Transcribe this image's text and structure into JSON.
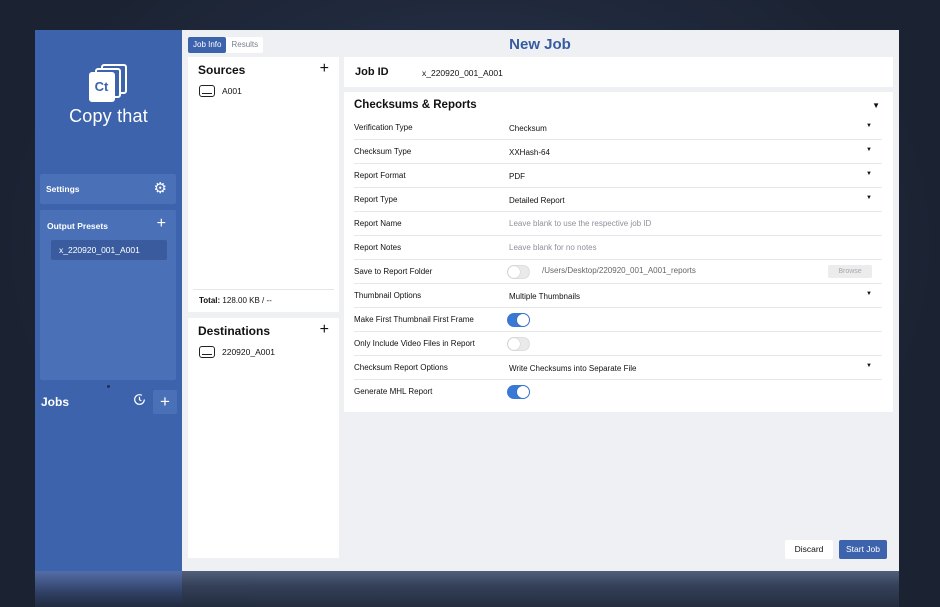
{
  "app": {
    "brand": "Copy that",
    "logo_badge": "Ct",
    "page_title": "New Job",
    "accent_color": "#3d63ac"
  },
  "tabs": [
    {
      "label": "Job Info",
      "active": true
    },
    {
      "label": "Results",
      "active": false
    }
  ],
  "sidebar": {
    "settings_label": "Settings",
    "settings_icon": "gear-icon",
    "output_presets_label": "Output Presets",
    "presets": [
      "x_220920_001_A001"
    ],
    "jobs_label": "Jobs",
    "history_icon": "history-icon"
  },
  "sources": {
    "title": "Sources",
    "items": [
      "A001"
    ],
    "total_label": "Total:",
    "total_value": "128.00 KB / --"
  },
  "destinations": {
    "title": "Destinations",
    "items": [
      "220920_A001"
    ]
  },
  "job": {
    "id_label": "Job ID",
    "id_value": "x_220920_001_A001"
  },
  "reports": {
    "title": "Checksums & Reports",
    "rows": [
      {
        "label": "Verification Type",
        "value": "Checksum"
      },
      {
        "label": "Checksum Type",
        "value": "XXHash-64"
      },
      {
        "label": "Report Format",
        "value": "PDF"
      },
      {
        "label": "Report Type",
        "value": "Detailed Report"
      },
      {
        "label": "Report Name",
        "placeholder": "Leave blank to use the respective job ID"
      },
      {
        "label": "Report Notes",
        "placeholder": "Leave blank for no notes"
      },
      {
        "label": "Save to Report Folder",
        "path": "/Users/Desktop/220920_001_A001_reports",
        "button": "Browse",
        "toggle": false
      },
      {
        "label": "Thumbnail Options",
        "value": "Multiple Thumbnails"
      },
      {
        "label": "Make First Thumbnail First Frame",
        "toggle": true
      },
      {
        "label": "Only Include Video Files in Report",
        "toggle": false
      },
      {
        "label": "Checksum Report Options",
        "value": "Write Checksums into Separate File"
      },
      {
        "label": "Generate MHL Report",
        "toggle": true
      }
    ]
  },
  "actions": {
    "discard": "Discard",
    "start": "Start Job"
  }
}
